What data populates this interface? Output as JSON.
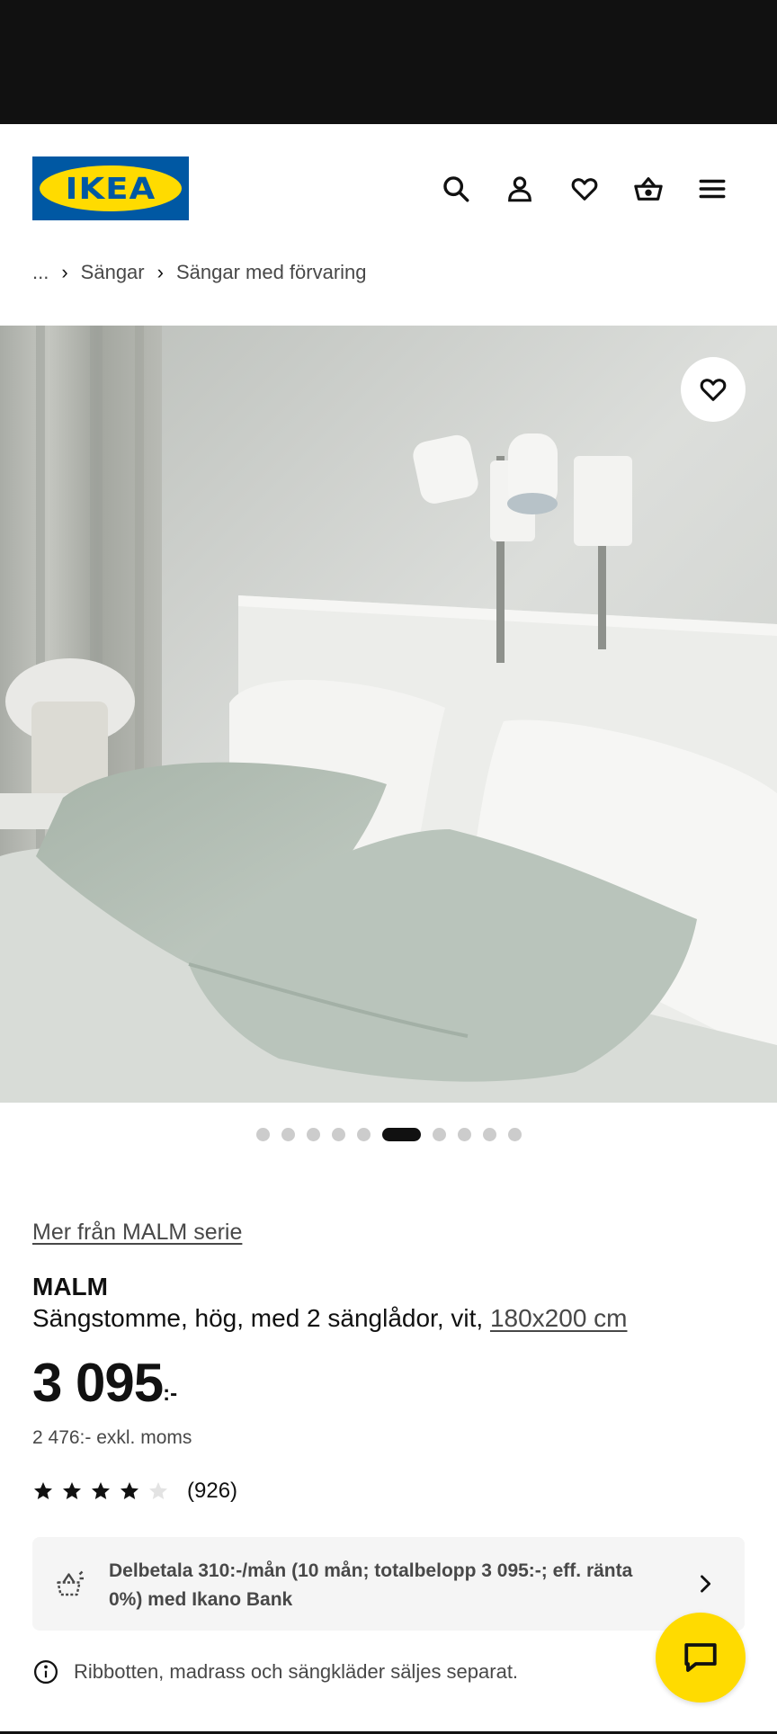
{
  "header": {
    "logo_text": "IKEA",
    "icons": [
      "search-icon",
      "account-icon",
      "heart-icon",
      "basket-icon",
      "menu-icon"
    ]
  },
  "breadcrumb": {
    "ellipsis": "...",
    "items": [
      "Sängar",
      "Sängar med förvaring"
    ]
  },
  "gallery": {
    "dot_count": 10,
    "active_index": 5
  },
  "product": {
    "series_link": "Mer från MALM serie",
    "name": "MALM",
    "description": "Sängstomme, hög, med 2 sänglådor, vit,",
    "size": "180x200 cm",
    "price": "3 095",
    "price_suffix": ":-",
    "price_excl": "2 476:- exkl. moms",
    "rating": 4.0,
    "rating_count": "(926)"
  },
  "finance": {
    "text": "Delbetala 310:-/mån (10 mån; totalbelopp 3 095:-; eff. ränta 0%) med Ikano Bank"
  },
  "info": {
    "text": "Ribbotten, madrass och sängkläder säljes separat."
  },
  "colors": {
    "brand_blue": "#0058a3",
    "brand_yellow": "#ffdb00",
    "text_primary": "#111111",
    "text_secondary": "#484848"
  }
}
